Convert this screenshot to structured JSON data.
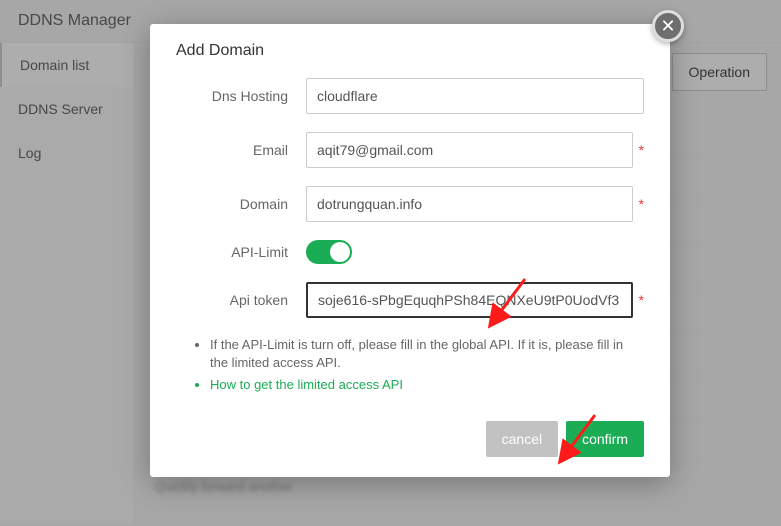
{
  "header": {
    "title": "DDNS Manager"
  },
  "sidebar": {
    "items": [
      {
        "label": "Domain list"
      },
      {
        "label": "DDNS Server"
      },
      {
        "label": "Log"
      }
    ]
  },
  "main": {
    "operation_label": "Operation"
  },
  "dialog": {
    "title": "Add Domain",
    "fields": {
      "dns_hosting": {
        "label": "Dns Hosting",
        "value": "cloudflare"
      },
      "email": {
        "label": "Email",
        "value": "aqit79@gmail.com"
      },
      "domain": {
        "label": "Domain",
        "value": "dotrungquan.info"
      },
      "api_limit": {
        "label": "API-Limit"
      },
      "api_token": {
        "label": "Api token",
        "value": "soje616-sPbgEquqhPSh84EQNXeU9tP0UodVf3"
      }
    },
    "notes": {
      "line1": "If the API-Limit is turn off, please fill in the global API. If it is, please fill in the limited access API.",
      "link": "How to get the limited access API"
    },
    "actions": {
      "cancel": "cancel",
      "confirm": "confirm"
    }
  }
}
